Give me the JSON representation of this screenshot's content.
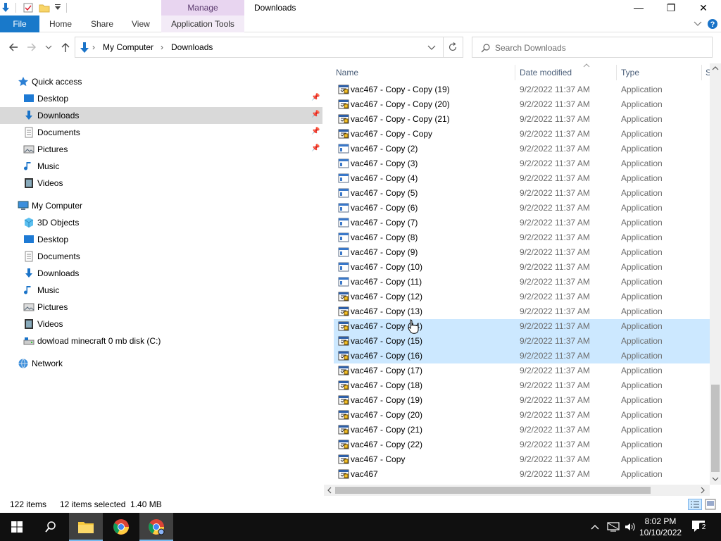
{
  "titlebar": {
    "manage_label": "Manage",
    "window_title": "Downloads",
    "minimize": "—",
    "maximize": "❐",
    "close": "✕"
  },
  "ribbon": {
    "file": "File",
    "home": "Home",
    "share": "Share",
    "view": "View",
    "app_tools": "Application Tools"
  },
  "address": {
    "crumbs": [
      "My Computer",
      "Downloads"
    ],
    "separator": "›"
  },
  "search": {
    "placeholder": "Search Downloads"
  },
  "nav_pane": {
    "items": [
      {
        "label": "Quick access",
        "icon": "star-icon"
      },
      {
        "label": "Desktop",
        "icon": "desktop-icon"
      },
      {
        "label": "Downloads",
        "icon": "download-arrow-icon"
      },
      {
        "label": "Documents",
        "icon": "documents-icon"
      },
      {
        "label": "Pictures",
        "icon": "pictures-icon"
      },
      {
        "label": "Music",
        "icon": "music-icon"
      },
      {
        "label": "Videos",
        "icon": "videos-icon"
      },
      {
        "label": "My Computer",
        "icon": "computer-icon"
      },
      {
        "label": "3D Objects",
        "icon": "cube-icon"
      },
      {
        "label": "Desktop",
        "icon": "desktop-icon"
      },
      {
        "label": "Documents",
        "icon": "documents-icon"
      },
      {
        "label": "Downloads",
        "icon": "download-arrow-icon"
      },
      {
        "label": "Music",
        "icon": "music-icon"
      },
      {
        "label": "Pictures",
        "icon": "pictures-icon"
      },
      {
        "label": "Videos",
        "icon": "videos-icon"
      },
      {
        "label": "dowload minecraft 0 mb disk (C:)",
        "icon": "drive-icon"
      },
      {
        "label": "Network",
        "icon": "network-icon"
      }
    ]
  },
  "columns": {
    "name": "Name",
    "date": "Date modified",
    "type": "Type",
    "size": "S"
  },
  "files": [
    {
      "name": "vac467 - Copy - Copy (19)",
      "date": "9/2/2022 11:37 AM",
      "type": "Application",
      "icon": "app-exe-icon",
      "selected": false
    },
    {
      "name": "vac467 - Copy - Copy (20)",
      "date": "9/2/2022 11:37 AM",
      "type": "Application",
      "icon": "app-exe-icon",
      "selected": false
    },
    {
      "name": "vac467 - Copy - Copy (21)",
      "date": "9/2/2022 11:37 AM",
      "type": "Application",
      "icon": "app-exe-icon",
      "selected": false
    },
    {
      "name": "vac467 - Copy - Copy",
      "date": "9/2/2022 11:37 AM",
      "type": "Application",
      "icon": "app-exe-icon",
      "selected": false
    },
    {
      "name": "vac467 - Copy (2)",
      "date": "9/2/2022 11:37 AM",
      "type": "Application",
      "icon": "app-window-icon",
      "selected": false
    },
    {
      "name": "vac467 - Copy (3)",
      "date": "9/2/2022 11:37 AM",
      "type": "Application",
      "icon": "app-window-icon",
      "selected": false
    },
    {
      "name": "vac467 - Copy (4)",
      "date": "9/2/2022 11:37 AM",
      "type": "Application",
      "icon": "app-window-icon",
      "selected": false
    },
    {
      "name": "vac467 - Copy (5)",
      "date": "9/2/2022 11:37 AM",
      "type": "Application",
      "icon": "app-window-icon",
      "selected": false
    },
    {
      "name": "vac467 - Copy (6)",
      "date": "9/2/2022 11:37 AM",
      "type": "Application",
      "icon": "app-window-icon",
      "selected": false
    },
    {
      "name": "vac467 - Copy (7)",
      "date": "9/2/2022 11:37 AM",
      "type": "Application",
      "icon": "app-window-icon",
      "selected": false
    },
    {
      "name": "vac467 - Copy (8)",
      "date": "9/2/2022 11:37 AM",
      "type": "Application",
      "icon": "app-window-icon",
      "selected": false
    },
    {
      "name": "vac467 - Copy (9)",
      "date": "9/2/2022 11:37 AM",
      "type": "Application",
      "icon": "app-window-icon",
      "selected": false
    },
    {
      "name": "vac467 - Copy (10)",
      "date": "9/2/2022 11:37 AM",
      "type": "Application",
      "icon": "app-window-icon",
      "selected": false
    },
    {
      "name": "vac467 - Copy (11)",
      "date": "9/2/2022 11:37 AM",
      "type": "Application",
      "icon": "app-window-icon",
      "selected": false
    },
    {
      "name": "vac467 - Copy (12)",
      "date": "9/2/2022 11:37 AM",
      "type": "Application",
      "icon": "app-exe-icon",
      "selected": false
    },
    {
      "name": "vac467 - Copy (13)",
      "date": "9/2/2022 11:37 AM",
      "type": "Application",
      "icon": "app-exe-icon",
      "selected": false
    },
    {
      "name": "vac467 - Copy (14)",
      "date": "9/2/2022 11:37 AM",
      "type": "Application",
      "icon": "app-exe-icon",
      "selected": true
    },
    {
      "name": "vac467 - Copy (15)",
      "date": "9/2/2022 11:37 AM",
      "type": "Application",
      "icon": "app-exe-icon",
      "selected": true
    },
    {
      "name": "vac467 - Copy (16)",
      "date": "9/2/2022 11:37 AM",
      "type": "Application",
      "icon": "app-exe-icon",
      "selected": true
    },
    {
      "name": "vac467 - Copy (17)",
      "date": "9/2/2022 11:37 AM",
      "type": "Application",
      "icon": "app-exe-icon",
      "selected": false
    },
    {
      "name": "vac467 - Copy (18)",
      "date": "9/2/2022 11:37 AM",
      "type": "Application",
      "icon": "app-exe-icon",
      "selected": false
    },
    {
      "name": "vac467 - Copy (19)",
      "date": "9/2/2022 11:37 AM",
      "type": "Application",
      "icon": "app-exe-icon",
      "selected": false
    },
    {
      "name": "vac467 - Copy (20)",
      "date": "9/2/2022 11:37 AM",
      "type": "Application",
      "icon": "app-exe-icon",
      "selected": false
    },
    {
      "name": "vac467 - Copy (21)",
      "date": "9/2/2022 11:37 AM",
      "type": "Application",
      "icon": "app-exe-icon",
      "selected": false
    },
    {
      "name": "vac467 - Copy (22)",
      "date": "9/2/2022 11:37 AM",
      "type": "Application",
      "icon": "app-exe-icon",
      "selected": false
    },
    {
      "name": "vac467 - Copy",
      "date": "9/2/2022 11:37 AM",
      "type": "Application",
      "icon": "app-exe-icon",
      "selected": false
    },
    {
      "name": "vac467",
      "date": "9/2/2022 11:37 AM",
      "type": "Application",
      "icon": "app-exe-icon",
      "selected": false
    }
  ],
  "status": {
    "item_count": "122 items",
    "selection": "12 items selected  1.40 MB"
  },
  "taskbar": {
    "time": "8:02 PM",
    "date": "10/10/2022",
    "notification_count": "2"
  },
  "colors": {
    "accent": "#1979ca",
    "selection": "#cce8ff",
    "manage_tab": "#e8d5f0",
    "taskbar": "#101010"
  }
}
